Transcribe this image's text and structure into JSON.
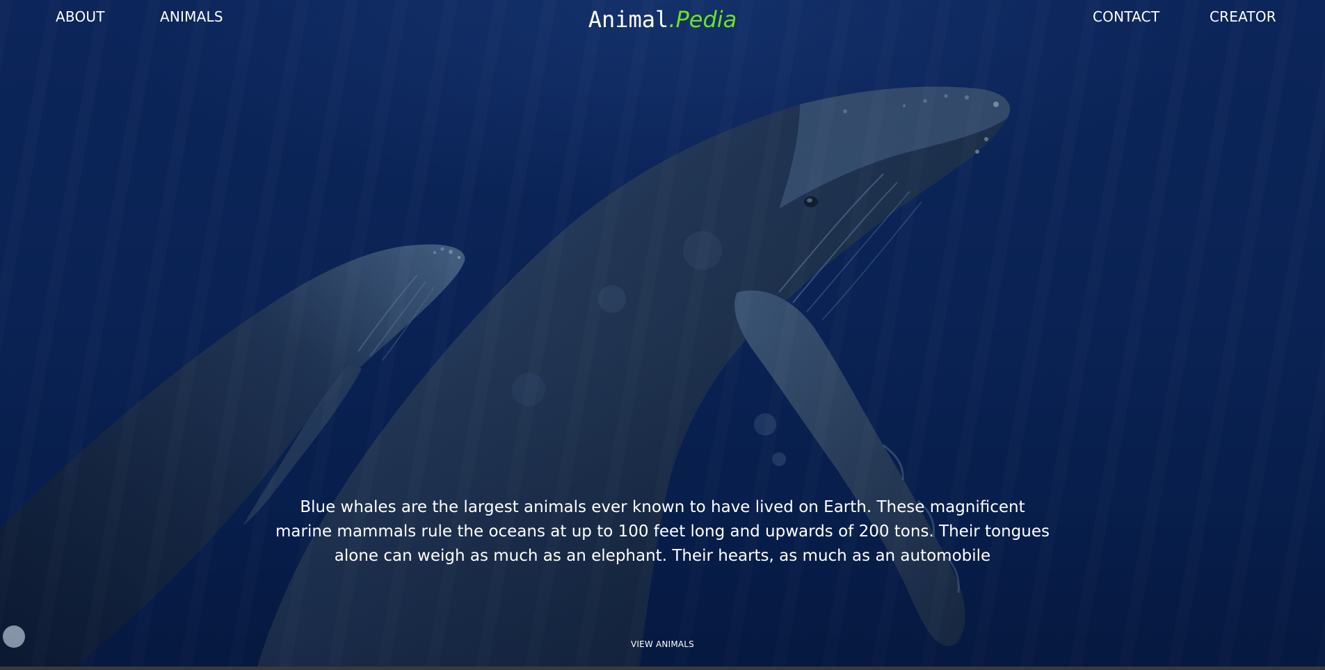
{
  "nav": {
    "left": [
      {
        "label": "ABOUT"
      },
      {
        "label": "ANIMALS"
      }
    ],
    "right": [
      {
        "label": "CONTACT"
      },
      {
        "label": "CREATOR"
      }
    ]
  },
  "logo": {
    "main": "Animal",
    "accent": ".Pedia"
  },
  "hero": {
    "image": "humpback-whales-underwater",
    "description": "Blue whales are the largest animals ever known to have lived on Earth. These magnificent marine mammals rule the oceans at up to 100 feet long and upwards of 200 tons. Their tongues alone can weigh as much as an elephant. Their hearts, as much as an automobile",
    "cta_label": "VIEW ANIMALS"
  },
  "colors": {
    "background": "#0b2457",
    "text": "#ffffff",
    "accent": "#6ee31f"
  }
}
